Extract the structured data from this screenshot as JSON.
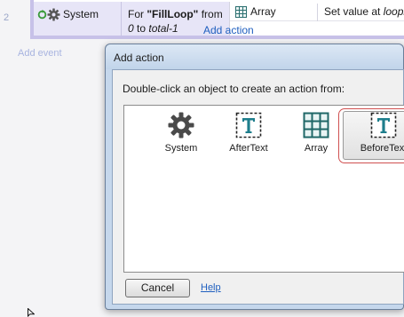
{
  "event_sheet": {
    "row_number": "2",
    "condition": {
      "object_label": "System",
      "text_prefix": "For ",
      "text_loop_name": "\"FillLoop\"",
      "text_from": " from",
      "text_range_start": "0",
      "text_to": " to ",
      "text_range_end": "total-1"
    },
    "action": {
      "object_label": "Array",
      "text_prefix": "Set value at ",
      "text_loop": "loopin"
    },
    "add_action_label": "Add action",
    "add_event_label": "Add event"
  },
  "dialog": {
    "title": "Add action",
    "instruction": "Double-click an object to create an action from:",
    "objects": [
      {
        "label": "System",
        "icon": "gear-icon"
      },
      {
        "label": "AfterText",
        "icon": "text-object-icon"
      },
      {
        "label": "Array",
        "icon": "array-grid-icon"
      },
      {
        "label": "BeforeText",
        "icon": "text-object-icon",
        "selected": true
      }
    ],
    "cancel_label": "Cancel",
    "help_label": "Help"
  },
  "colors": {
    "accent_link": "#1f5fbf",
    "selection_outline": "#d05050",
    "text_icon_teal": "#1e7e8c"
  }
}
